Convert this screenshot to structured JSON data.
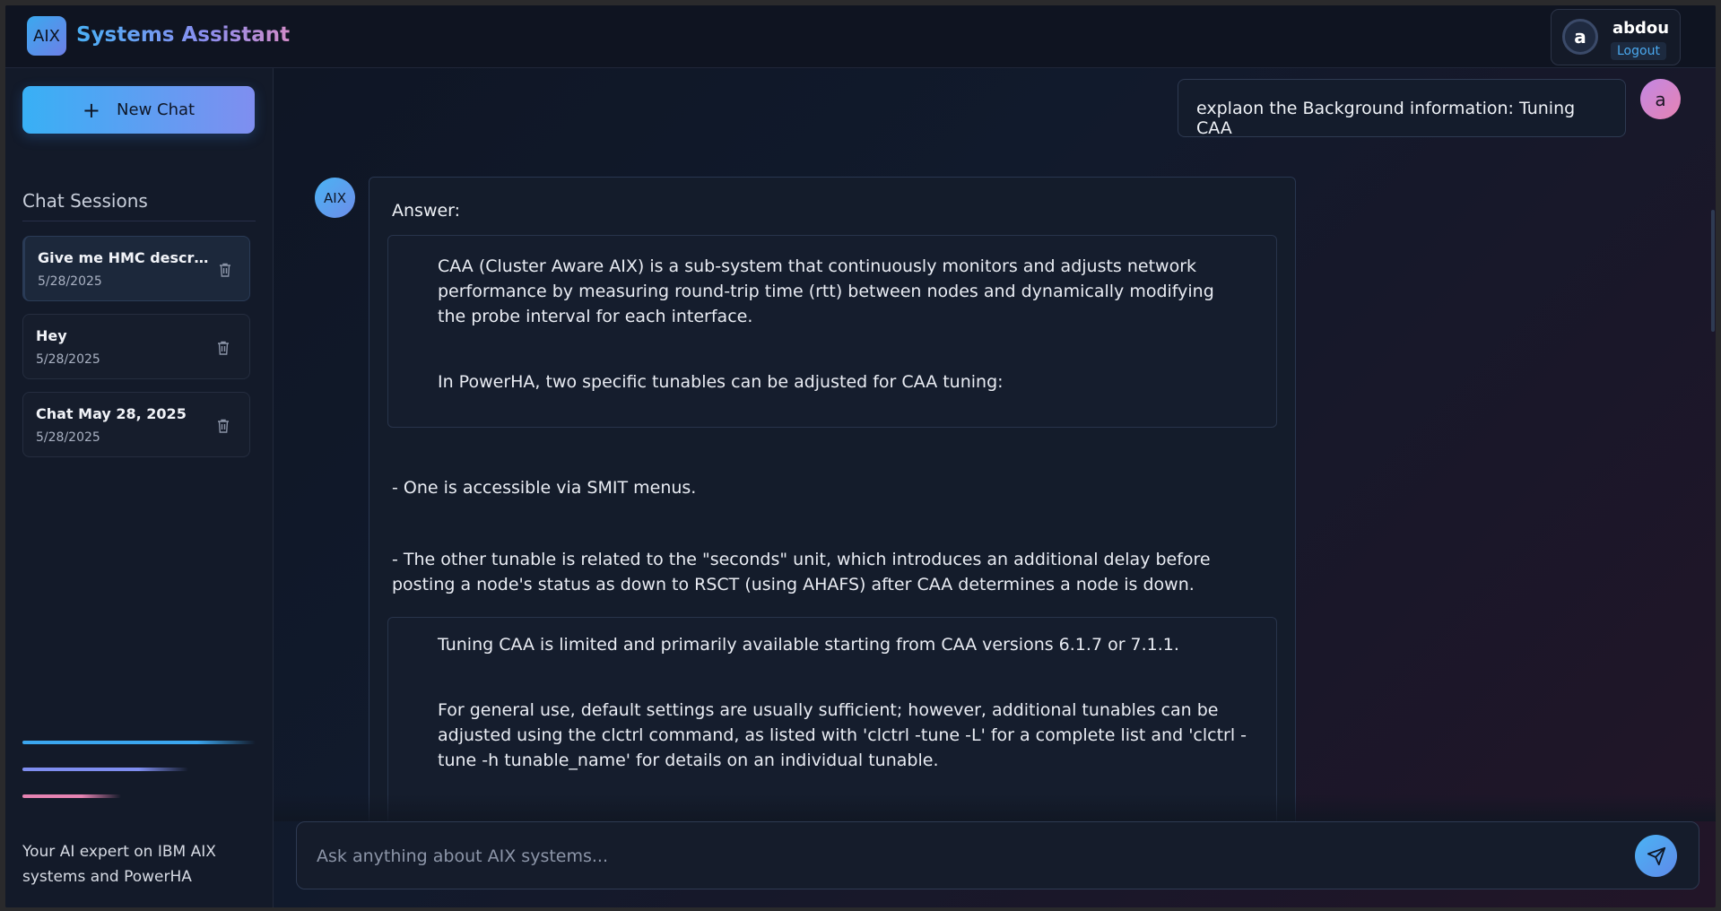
{
  "app": {
    "logo_text": "AIX",
    "title": "Systems Assistant"
  },
  "user": {
    "avatar_letter": "a",
    "name": "abdou",
    "logout_label": "Logout"
  },
  "sidebar": {
    "new_chat_label": "New Chat",
    "sessions_title": "Chat Sessions",
    "sessions": [
      {
        "title": "Give me HMC description",
        "date": "5/28/2025",
        "active": true
      },
      {
        "title": "Hey",
        "date": "5/28/2025",
        "active": false
      },
      {
        "title": "Chat May 28, 2025",
        "date": "5/28/2025",
        "active": false
      }
    ],
    "tagline": "Your AI expert on IBM AIX systems and PowerHA"
  },
  "conversation": {
    "user_message": "explaon the Background information: Tuning CAA",
    "user_avatar_letter": "a",
    "bot_avatar_text": "AIX",
    "answer_label": "Answer:",
    "quote1": [
      "CAA (Cluster Aware AIX) is a sub-system that continuously monitors and adjusts network performance by measuring round-trip time (rtt) between nodes and dynamically modifying the probe interval for each interface.",
      "In PowerHA, two specific tunables can be adjusted for CAA tuning:"
    ],
    "bullets": [
      " - One is accessible via SMIT menus.",
      " - The other tunable is related to the \"seconds\" unit, which introduces an additional delay before posting a node's status as down to RSCT (using AHAFS) after CAA determines a node is down."
    ],
    "quote2": [
      "Tuning CAA is limited and primarily available starting from CAA versions 6.1.7 or 7.1.1.",
      "For general use, default settings are usually sufficient; however, additional tunables can be adjusted using the clctrl command, as listed with 'clctrl -tune -L' for a complete list and 'clctrl -tune -h tunable_name' for details on an individual tunable."
    ]
  },
  "input": {
    "placeholder": "Ask anything about AIX systems..."
  },
  "colors": {
    "accent_blue": "#3ba6ef",
    "accent_purple": "#7f8ef0",
    "accent_pink": "#e683b2"
  }
}
